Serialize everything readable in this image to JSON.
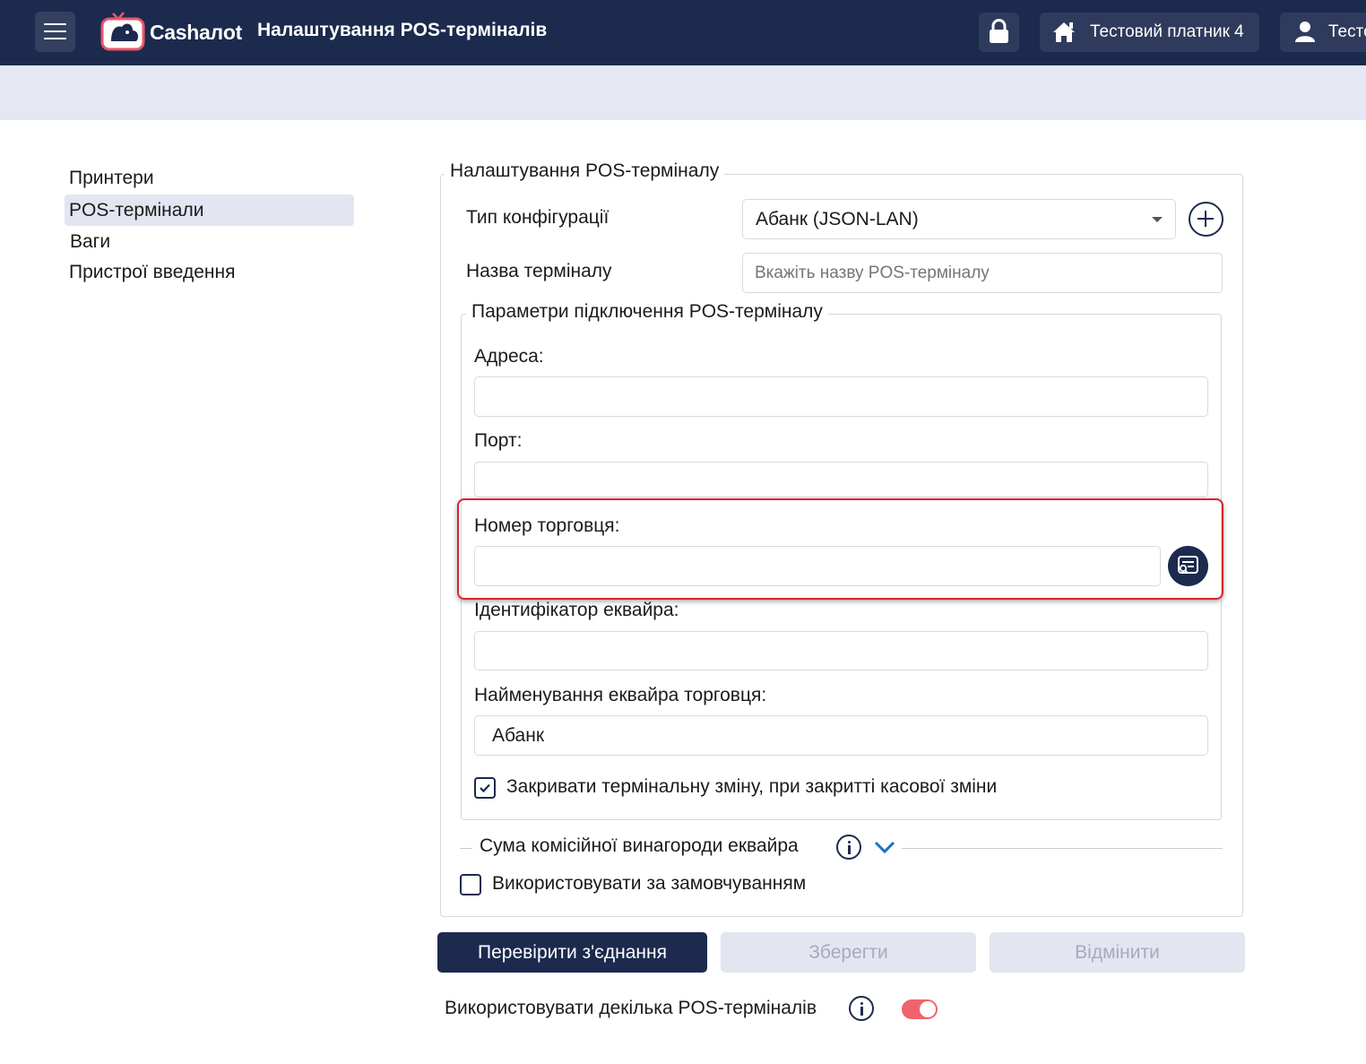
{
  "header": {
    "logo_text": "Cashалot",
    "title": "Налаштування POS-терміналів",
    "organization": "Тестовий платник 4",
    "user": "Тестовий",
    "menu_icon": "hamburger-icon",
    "lock_icon": "lock-icon",
    "home_icon": "home-icon",
    "user_icon": "user-icon",
    "colors": {
      "header_bg": "#1c2a4e",
      "subbar_bg": "#e5e7f3",
      "accent": "#f0636d"
    }
  },
  "sidebar": {
    "items": [
      {
        "label": "Принтери",
        "active": false
      },
      {
        "label": "POS-термінали",
        "active": true
      },
      {
        "label": "Ваги",
        "active": false
      },
      {
        "label": "Пристрої введення",
        "active": false
      }
    ]
  },
  "form": {
    "legend": "Налаштування POS-терміналу",
    "config_type_label": "Тип конфігурації",
    "config_type_value": "Абанк (JSON-LAN)",
    "terminal_name_label": "Назва терміналу",
    "terminal_name_placeholder": "Вкажіть назву POS-терміналу",
    "terminal_name_value": "",
    "connection": {
      "legend": "Параметри підключення POS-терміналу",
      "address_label": "Адреса:",
      "address_value": "",
      "port_label": "Порт:",
      "port_value": "",
      "merchant_label": "Номер торговця:",
      "merchant_value": "",
      "acquirer_id_label": "Ідентифікатор еквайра:",
      "acquirer_id_value": "",
      "acquirer_name_label": "Найменування еквайра торговця:",
      "acquirer_name_value": "Абанк",
      "close_shift_label": "Закривати термінальну зміну, при закритті касової зміни",
      "close_shift_checked": true
    },
    "commission_label": "Сума комісійної винагороди еквайра",
    "use_default_label": "Використовувати за замовчуванням",
    "use_default_checked": false
  },
  "actions": {
    "check_connection": "Перевірити з'єднання",
    "save": "Зберегти",
    "cancel": "Відмінити"
  },
  "multi_terminal": {
    "label": "Використовувати декілька POS-терміналів",
    "enabled": true
  }
}
